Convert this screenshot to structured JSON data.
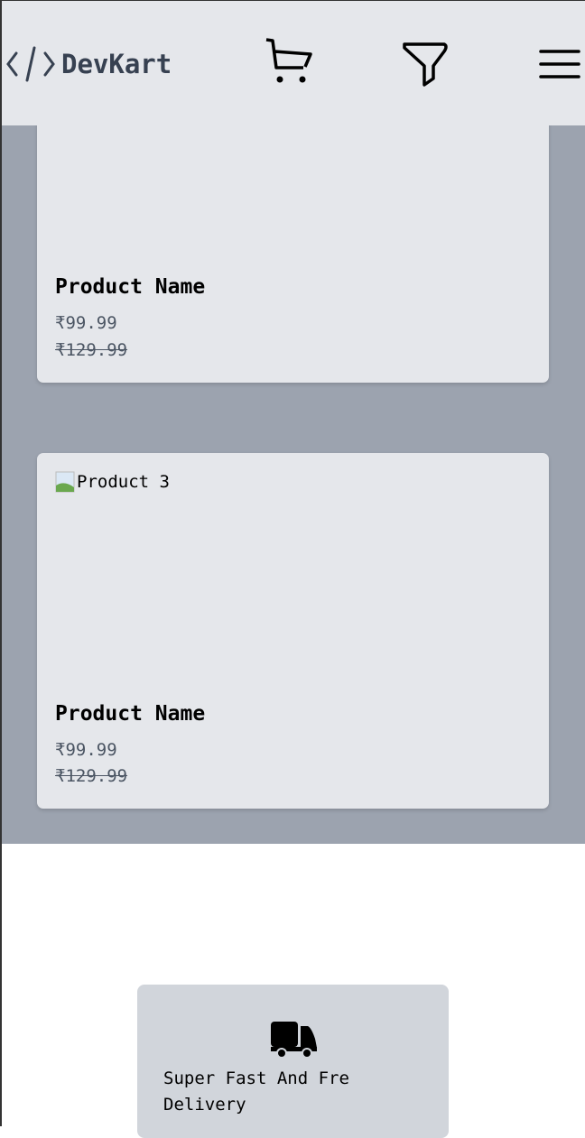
{
  "header": {
    "brand": "DevKart",
    "icons": [
      "code-icon",
      "cart-icon",
      "filter-icon",
      "menu-icon"
    ]
  },
  "products": [
    {
      "name": "Product Name",
      "price": "₹99.99",
      "original_price": "₹129.99"
    },
    {
      "image_alt": "Product 3",
      "name": "Product Name",
      "price": "₹99.99",
      "original_price": "₹129.99"
    }
  ],
  "features": [
    {
      "icon": "truck-icon",
      "text": "Super Fast And Fre Delivery"
    }
  ]
}
